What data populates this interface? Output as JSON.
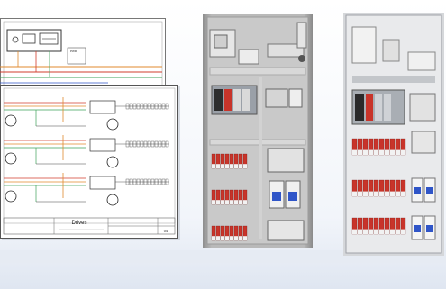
{
  "drawings": {
    "back_sheet_labels": [
      "",
      ""
    ],
    "front_sheet": {
      "title": "Drives",
      "sheet_number": "04"
    }
  },
  "colors": {
    "backdrop": "#e9eef6",
    "shadow": "#d6dde8",
    "wire_red": "#d23c2c",
    "wire_orange": "#e08a2e",
    "wire_green": "#3ea35a",
    "wire_blue": "#2f55c8",
    "panel_grey": "#c8c8c8",
    "terminal_red": "#c8342a",
    "plc_grey": "#9aa0a8"
  },
  "icons": [
    "schematic-sheet-back",
    "schematic-sheet-front",
    "cabinet-render",
    "cabinet-photo"
  ]
}
